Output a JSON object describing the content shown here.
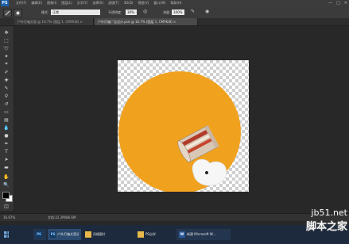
{
  "app": {
    "logo": "PS"
  },
  "menubar": {
    "items": [
      "文件(F)",
      "编辑(E)",
      "图像(I)",
      "图层(L)",
      "文字(Y)",
      "选择(S)",
      "滤镜(T)",
      "3D(D)",
      "视图(V)",
      "窗口(W)",
      "帮助(H)"
    ],
    "window_controls": [
      "—",
      "□",
      "✕"
    ]
  },
  "options": {
    "mode_label": "模式:",
    "mode_value": "正常",
    "opacity_label": "不透明度:",
    "opacity_value": "30%",
    "flow_label": "流量:",
    "flow_value": "100%"
  },
  "tabs": [
    {
      "label": "户外灯箱文案 @ 16.7% (图层 1, CMYK/8) ×",
      "active": false
    },
    {
      "label": "户外灯箱广告设计.psd @ 16.7% (图层 1, CMYK/8) ×",
      "active": true
    }
  ],
  "status": {
    "zoom": "16.67%",
    "doc_info": "文档:22.2M/86.6M"
  },
  "colors": {
    "accent_circle": "#f0a21f",
    "foreground": "#000000",
    "background": "#ffffff"
  },
  "taskbar": {
    "items": [
      {
        "icon": "PS",
        "label": ""
      },
      {
        "icon": "PS",
        "label": "户外灯箱文案设计.ps..."
      },
      {
        "icon": "folder-icon",
        "label": "风格图片"
      },
      {
        "icon": "folder-icon",
        "label": "PS自学"
      },
      {
        "icon": "W",
        "label": "新建 Microsoft W..."
      }
    ]
  },
  "watermark": {
    "url": "jb51.net",
    "name": "脚本之家"
  }
}
